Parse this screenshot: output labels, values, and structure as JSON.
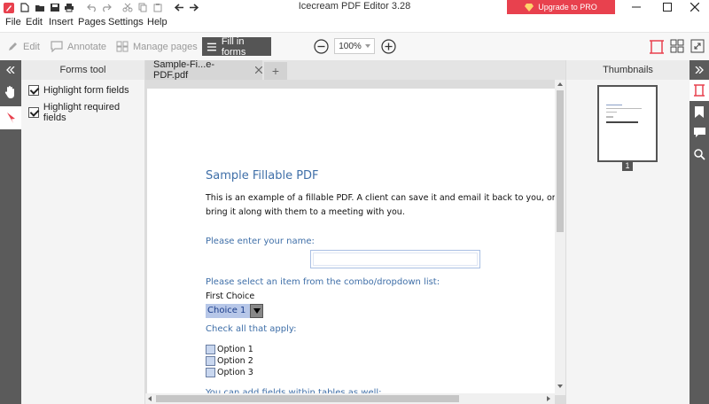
{
  "app": {
    "title": "Icecream PDF Editor 3.28",
    "upgrade_label": "Upgrade to PRO",
    "accent": "#e8414e"
  },
  "menu": [
    "File",
    "Edit",
    "Insert",
    "Pages",
    "Settings",
    "Help"
  ],
  "toolbar": {
    "modes": [
      {
        "label": "Edit",
        "icon": "pencil-icon",
        "active": false
      },
      {
        "label": "Annotate",
        "icon": "comment-icon",
        "active": false
      },
      {
        "label": "Manage pages",
        "icon": "pages-icon",
        "active": false
      },
      {
        "label": "Fill in forms",
        "icon": "form-icon",
        "active": true
      }
    ],
    "zoom": "100%"
  },
  "forms_panel": {
    "title": "Forms tool",
    "options": [
      {
        "label": "Highlight form fields",
        "checked": true
      },
      {
        "label": "Highlight required fields",
        "checked": true
      }
    ]
  },
  "tab": {
    "label": "Sample-Fi...e-PDF.pdf",
    "add_label": "+"
  },
  "document": {
    "title": "Sample Fillable PDF",
    "intro_line1": "This is an example of a fillable PDF. A client can save it and email it back to you, or print it",
    "intro_line2": "bring it along with them to a meeting with you.",
    "name_prompt": "Please enter your name:",
    "name_value": "",
    "combo_prompt": "Please select an item from the combo/dropdown list:",
    "combo_caption": "First Choice",
    "combo_value": "Choice 1",
    "check_prompt": "Check all that apply:",
    "options": [
      "Option 1",
      "Option 2",
      "Option 3"
    ],
    "table_prompt": "You can add  fields within tables as well:"
  },
  "thumbnails": {
    "title": "Thumbnails",
    "page_number": "1"
  }
}
